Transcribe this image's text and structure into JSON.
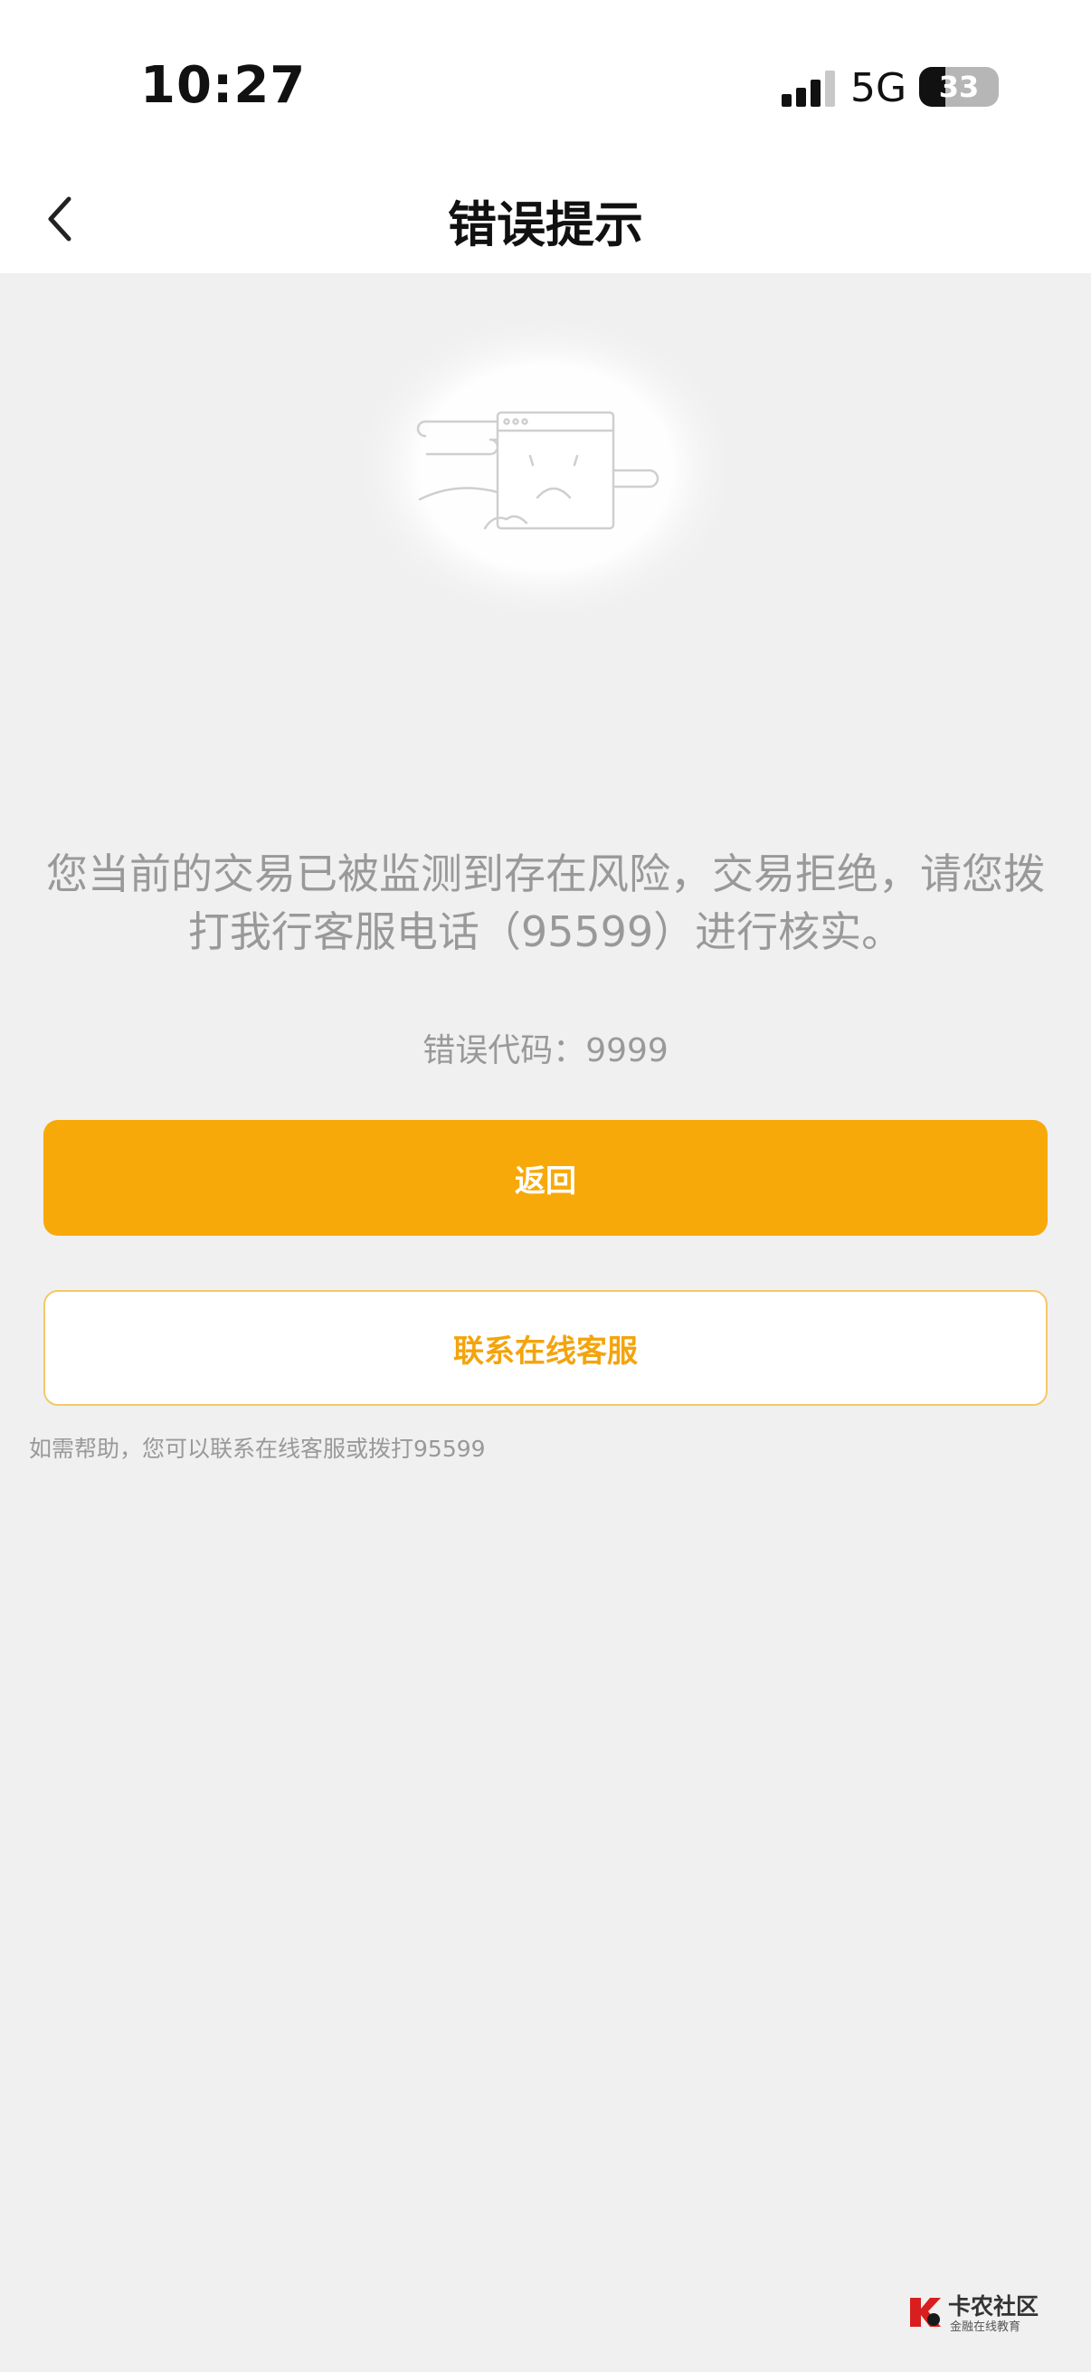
{
  "status_bar": {
    "time": "10:27",
    "network": "5G",
    "battery": "33",
    "battery_level": 0.33,
    "signal_icon": "signal-bars-icon",
    "battery_icon": "battery-icon"
  },
  "nav": {
    "title": "错误提示",
    "back_icon": "chevron-left-icon"
  },
  "illustration_icon": "sad-browser-window-icon",
  "main": {
    "message": "您当前的交易已被监测到存在风险，交易拒绝，请您拨打我行客服电话（95599）进行核实。",
    "error_code": "错误代码：9999",
    "back_button_label": "返回",
    "contact_button_label": "联系在线客服",
    "help_text": "如需帮助，您可以联系在线客服或拨打95599"
  },
  "watermark": {
    "title": "卡农社区",
    "subtitle": "金融在线教育"
  },
  "colors": {
    "primary": "#f8a90a",
    "secondary_text": "#f3a40d",
    "muted_text": "#999999",
    "background": "#f0f0f0"
  }
}
